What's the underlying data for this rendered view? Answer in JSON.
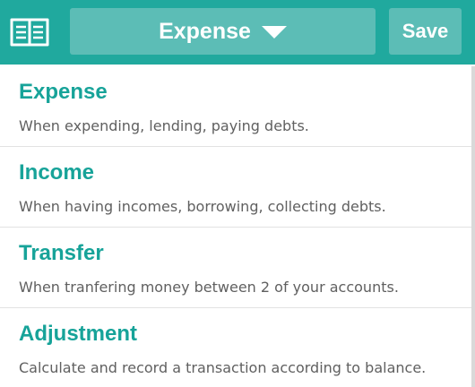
{
  "header": {
    "book_icon": "open-book-icon",
    "selector_label": "Expense",
    "selector_icon": "caret-down-icon",
    "save_label": "Save"
  },
  "colors": {
    "header_bg": "#20a99e",
    "button_bg": "#5cbdb6",
    "title_text": "#17a399",
    "description_text": "#606060"
  },
  "options": [
    {
      "title": "Expense",
      "description": "When expending, lending, paying debts."
    },
    {
      "title": "Income",
      "description": "When having incomes, borrowing, collecting debts."
    },
    {
      "title": "Transfer",
      "description": "When tranfering money between 2 of your accounts."
    },
    {
      "title": "Adjustment",
      "description": "Calculate and record a transaction according to balance."
    }
  ]
}
